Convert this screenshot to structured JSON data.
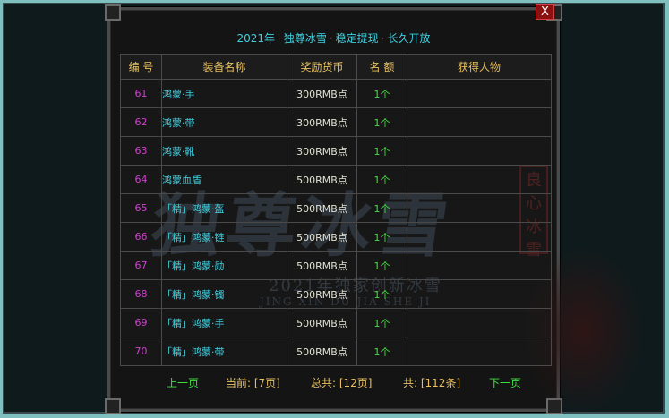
{
  "header": {
    "parts": [
      "2021年",
      "独尊冰雪",
      "稳定提现",
      "长久开放"
    ],
    "separator": "·"
  },
  "close_label": "X",
  "watermark": {
    "title": "独尊冰雪",
    "subtitle": "2021年独家创新冰雪",
    "pinyin": "JING XIN DU JIA SHE JI",
    "seal": [
      "良",
      "心",
      "冰",
      "雪"
    ]
  },
  "table": {
    "columns": [
      "编 号",
      "装备名称",
      "奖励货币",
      "名 额",
      "获得人物"
    ],
    "rows": [
      {
        "no": "61",
        "name": "鸿蒙·手",
        "reward": "300RMB点",
        "count": "1个",
        "who": ""
      },
      {
        "no": "62",
        "name": "鸿蒙·带",
        "reward": "300RMB点",
        "count": "1个",
        "who": ""
      },
      {
        "no": "63",
        "name": "鸿蒙·靴",
        "reward": "300RMB点",
        "count": "1个",
        "who": ""
      },
      {
        "no": "64",
        "name": "鸿蒙血盾",
        "reward": "500RMB点",
        "count": "1个",
        "who": ""
      },
      {
        "no": "65",
        "name": "「精」鸿蒙·盔",
        "reward": "500RMB点",
        "count": "1个",
        "who": ""
      },
      {
        "no": "66",
        "name": "「精」鸿蒙·链",
        "reward": "500RMB点",
        "count": "1个",
        "who": ""
      },
      {
        "no": "67",
        "name": "「精」鸿蒙·勋",
        "reward": "500RMB点",
        "count": "1个",
        "who": ""
      },
      {
        "no": "68",
        "name": "「精」鸿蒙·镯",
        "reward": "500RMB点",
        "count": "1个",
        "who": ""
      },
      {
        "no": "69",
        "name": "「精」鸿蒙·手",
        "reward": "500RMB点",
        "count": "1个",
        "who": ""
      },
      {
        "no": "70",
        "name": "「精」鸿蒙·带",
        "reward": "500RMB点",
        "count": "1个",
        "who": ""
      }
    ]
  },
  "footer": {
    "prev": "上一页",
    "current": "当前: [7页]",
    "total_pages": "总共: [12页]",
    "total_items": "共: [112条]",
    "next": "下一页"
  }
}
